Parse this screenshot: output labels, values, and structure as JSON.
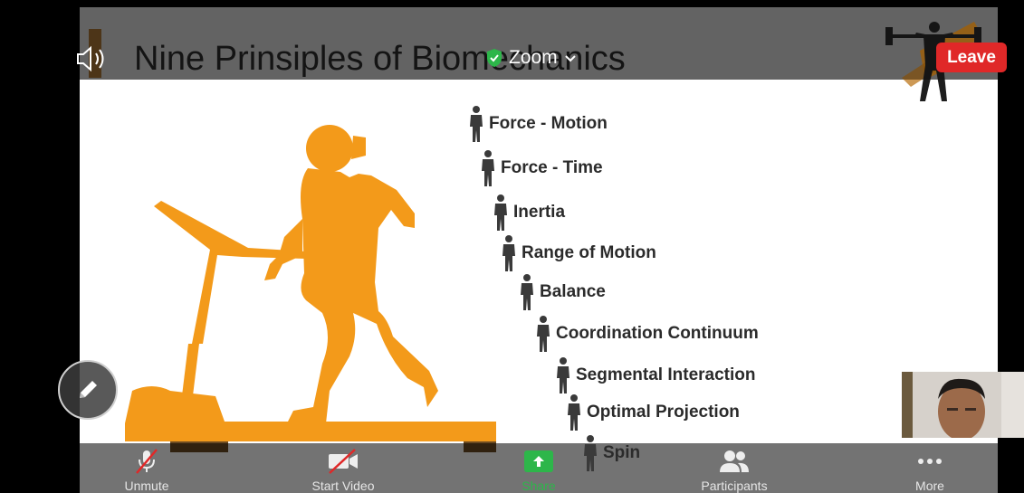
{
  "slide": {
    "title": "Nine Prinsiples of Biomechanics",
    "principles": [
      "Force - Motion",
      "Force - Time",
      "Inertia",
      "Range of Motion",
      "Balance",
      "Coordination Continuum",
      "Segmental Interaction",
      "Optimal Projection",
      "Spin"
    ],
    "accent_color": "#f39a1a",
    "icon": "person-figure-icon"
  },
  "meeting": {
    "app_title": "Zoom",
    "leave_label": "Leave"
  },
  "toolbar": {
    "unmute_label": "Unmute",
    "start_video_label": "Start Video",
    "share_label": "Share",
    "participants_label": "Participants",
    "more_label": "More"
  },
  "colors": {
    "leave": "#e02828",
    "share": "#2db64a",
    "mute_slash": "#e02828"
  }
}
